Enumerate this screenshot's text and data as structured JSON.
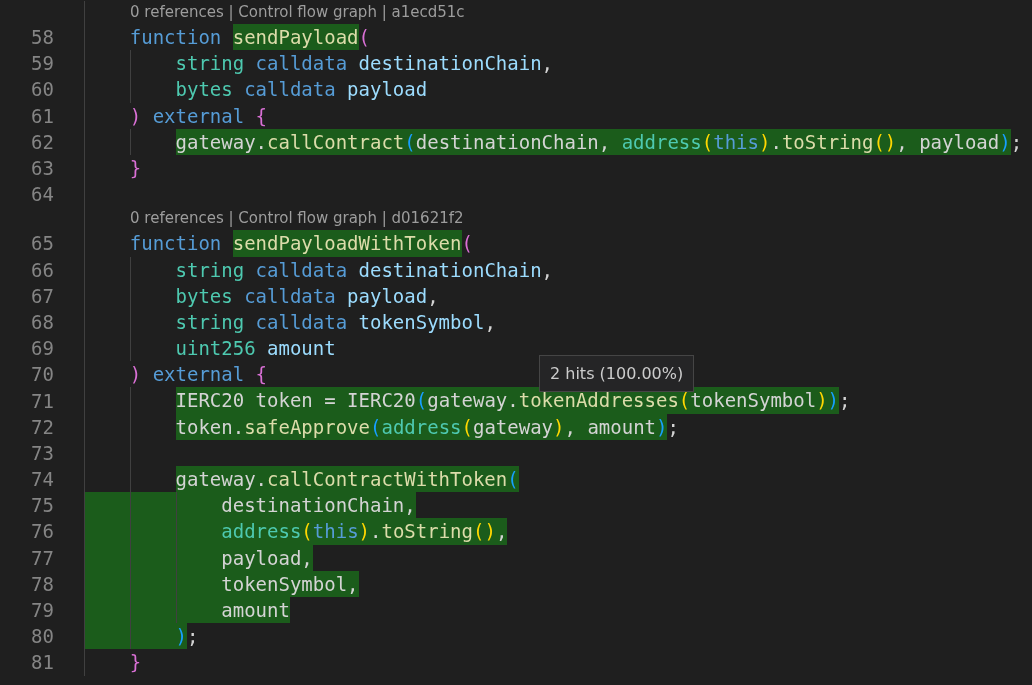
{
  "editor": {
    "rows": [
      {
        "kind": "lens",
        "text": "0 references | Control flow graph | a1ecd51c"
      },
      {
        "kind": "code",
        "number": "58",
        "indent": "    ",
        "segments": [
          {
            "text": "function ",
            "kind": "keyword",
            "covered": false
          },
          {
            "text": "sendPayload",
            "kind": "function",
            "covered": true
          },
          {
            "text": "(",
            "kind": "brackets1",
            "covered": false
          }
        ]
      },
      {
        "kind": "code",
        "number": "59",
        "indent": "        ",
        "segments": [
          {
            "text": "string ",
            "kind": "type",
            "covered": false
          },
          {
            "text": "calldata ",
            "kind": "keyword",
            "covered": false
          },
          {
            "text": "destinationChain",
            "kind": "param",
            "covered": false
          },
          {
            "text": ",",
            "kind": "plain",
            "covered": false
          }
        ]
      },
      {
        "kind": "code",
        "number": "60",
        "indent": "        ",
        "segments": [
          {
            "text": "bytes ",
            "kind": "type",
            "covered": false
          },
          {
            "text": "calldata ",
            "kind": "keyword",
            "covered": false
          },
          {
            "text": "payload",
            "kind": "param",
            "covered": false
          }
        ]
      },
      {
        "kind": "code",
        "number": "61",
        "indent": "    ",
        "segments": [
          {
            "text": ")",
            "kind": "brackets1",
            "covered": false
          },
          {
            "text": " external ",
            "kind": "keyword",
            "covered": false
          },
          {
            "text": "{",
            "kind": "brackets1",
            "covered": false
          }
        ]
      },
      {
        "kind": "code",
        "number": "62",
        "indent": "        ",
        "segments": [
          {
            "text": "gateway.",
            "kind": "plain",
            "covered": true
          },
          {
            "text": "callContract",
            "kind": "function",
            "covered": true
          },
          {
            "text": "(",
            "kind": "brackets2",
            "covered": true
          },
          {
            "text": "destinationChain, ",
            "kind": "plain",
            "covered": true
          },
          {
            "text": "address",
            "kind": "type",
            "covered": true
          },
          {
            "text": "(",
            "kind": "brackets3",
            "covered": true
          },
          {
            "text": "this",
            "kind": "keyword",
            "covered": true
          },
          {
            "text": ")",
            "kind": "brackets3",
            "covered": true
          },
          {
            "text": ".",
            "kind": "plain",
            "covered": true
          },
          {
            "text": "toString",
            "kind": "function",
            "covered": true
          },
          {
            "text": "()",
            "kind": "brackets3",
            "covered": true
          },
          {
            "text": ", payload",
            "kind": "plain",
            "covered": true
          },
          {
            "text": ")",
            "kind": "brackets2",
            "covered": true
          },
          {
            "text": ";",
            "kind": "plain",
            "covered": false
          }
        ]
      },
      {
        "kind": "code",
        "number": "63",
        "indent": "    ",
        "segments": [
          {
            "text": "}",
            "kind": "brackets1",
            "covered": false
          }
        ]
      },
      {
        "kind": "code",
        "number": "64"
      },
      {
        "kind": "lens",
        "text": "0 references | Control flow graph | d01621f2"
      },
      {
        "kind": "code",
        "number": "65",
        "indent": "    ",
        "segments": [
          {
            "text": "function ",
            "kind": "keyword",
            "covered": false
          },
          {
            "text": "sendPayloadWithToken",
            "kind": "function",
            "covered": true
          },
          {
            "text": "(",
            "kind": "brackets1",
            "covered": false
          }
        ]
      },
      {
        "kind": "code",
        "number": "66",
        "indent": "        ",
        "segments": [
          {
            "text": "string ",
            "kind": "type",
            "covered": false
          },
          {
            "text": "calldata ",
            "kind": "keyword",
            "covered": false
          },
          {
            "text": "destinationChain",
            "kind": "param",
            "covered": false
          },
          {
            "text": ",",
            "kind": "plain",
            "covered": false
          }
        ]
      },
      {
        "kind": "code",
        "number": "67",
        "indent": "        ",
        "segments": [
          {
            "text": "bytes ",
            "kind": "type",
            "covered": false
          },
          {
            "text": "calldata ",
            "kind": "keyword",
            "covered": false
          },
          {
            "text": "payload",
            "kind": "param",
            "covered": false
          },
          {
            "text": ",",
            "kind": "plain",
            "covered": false
          }
        ]
      },
      {
        "kind": "code",
        "number": "68",
        "indent": "        ",
        "segments": [
          {
            "text": "string ",
            "kind": "type",
            "covered": false
          },
          {
            "text": "calldata ",
            "kind": "keyword",
            "covered": false
          },
          {
            "text": "tokenSymbol",
            "kind": "param",
            "covered": false
          },
          {
            "text": ",",
            "kind": "plain",
            "covered": false
          }
        ]
      },
      {
        "kind": "code",
        "number": "69",
        "indent": "        ",
        "segments": [
          {
            "text": "uint256 ",
            "kind": "type",
            "covered": false
          },
          {
            "text": "amount",
            "kind": "param",
            "covered": false
          }
        ]
      },
      {
        "kind": "code",
        "number": "70",
        "indent": "    ",
        "segments": [
          {
            "text": ")",
            "kind": "brackets1",
            "covered": false
          },
          {
            "text": " external ",
            "kind": "keyword",
            "covered": false
          },
          {
            "text": "{",
            "kind": "brackets1",
            "covered": false
          }
        ]
      },
      {
        "kind": "code",
        "number": "71",
        "indent": "        ",
        "segments": [
          {
            "text": "IERC20 token = IERC20",
            "kind": "plain",
            "covered": true
          },
          {
            "text": "(",
            "kind": "brackets2",
            "covered": true
          },
          {
            "text": "gateway.",
            "kind": "plain",
            "covered": true
          },
          {
            "text": "tokenAddresses",
            "kind": "function",
            "covered": true
          },
          {
            "text": "(",
            "kind": "brackets3",
            "covered": true
          },
          {
            "text": "tokenSymbol",
            "kind": "plain",
            "covered": true
          },
          {
            "text": ")",
            "kind": "brackets3",
            "covered": true
          },
          {
            "text": ")",
            "kind": "brackets2",
            "covered": true
          },
          {
            "text": ";",
            "kind": "plain",
            "covered": false
          }
        ]
      },
      {
        "kind": "code",
        "number": "72",
        "indent": "        ",
        "segments": [
          {
            "text": "token.",
            "kind": "plain",
            "covered": true
          },
          {
            "text": "safeApprove",
            "kind": "function",
            "covered": true
          },
          {
            "text": "(",
            "kind": "brackets2",
            "covered": true
          },
          {
            "text": "address",
            "kind": "type",
            "covered": true
          },
          {
            "text": "(",
            "kind": "brackets3",
            "covered": true
          },
          {
            "text": "gateway",
            "kind": "plain",
            "covered": true
          },
          {
            "text": ")",
            "kind": "brackets3",
            "covered": true
          },
          {
            "text": ", amount",
            "kind": "plain",
            "covered": true
          },
          {
            "text": ")",
            "kind": "brackets2",
            "covered": true
          },
          {
            "text": ";",
            "kind": "plain",
            "covered": false
          }
        ]
      },
      {
        "kind": "code",
        "number": "73"
      },
      {
        "kind": "code",
        "number": "74",
        "indent": "        ",
        "segments": [
          {
            "text": "gateway.",
            "kind": "plain",
            "covered": true
          },
          {
            "text": "callContractWithToken",
            "kind": "function",
            "covered": true
          },
          {
            "text": "(",
            "kind": "brackets2",
            "covered": true
          }
        ]
      },
      {
        "kind": "code",
        "number": "75",
        "indent": "            ",
        "indent_covered": true,
        "segments": [
          {
            "text": "destinationChain,",
            "kind": "plain",
            "covered": true
          }
        ]
      },
      {
        "kind": "code",
        "number": "76",
        "indent": "            ",
        "indent_covered": true,
        "segments": [
          {
            "text": "address",
            "kind": "type",
            "covered": true
          },
          {
            "text": "(",
            "kind": "brackets3",
            "covered": true
          },
          {
            "text": "this",
            "kind": "keyword",
            "covered": true
          },
          {
            "text": ")",
            "kind": "brackets3",
            "covered": true
          },
          {
            "text": ".",
            "kind": "plain",
            "covered": true
          },
          {
            "text": "toString",
            "kind": "function",
            "covered": true
          },
          {
            "text": "()",
            "kind": "brackets3",
            "covered": true
          },
          {
            "text": ",",
            "kind": "plain",
            "covered": true
          }
        ]
      },
      {
        "kind": "code",
        "number": "77",
        "indent": "            ",
        "indent_covered": true,
        "segments": [
          {
            "text": "payload,",
            "kind": "plain",
            "covered": true
          }
        ]
      },
      {
        "kind": "code",
        "number": "78",
        "indent": "            ",
        "indent_covered": true,
        "segments": [
          {
            "text": "tokenSymbol,",
            "kind": "plain",
            "covered": true
          }
        ]
      },
      {
        "kind": "code",
        "number": "79",
        "indent": "            ",
        "indent_covered": true,
        "segments": [
          {
            "text": "amount",
            "kind": "plain",
            "covered": true
          }
        ]
      },
      {
        "kind": "code",
        "number": "80",
        "indent": "        ",
        "indent_covered": true,
        "segments": [
          {
            "text": ")",
            "kind": "brackets2",
            "covered": true
          },
          {
            "text": ";",
            "kind": "plain",
            "covered": false
          }
        ]
      },
      {
        "kind": "code",
        "number": "81",
        "indent": "    ",
        "segments": [
          {
            "text": "}",
            "kind": "brackets1",
            "covered": false
          }
        ]
      }
    ],
    "hover_tooltip": {
      "text": "2 hits (100.00%)"
    }
  }
}
